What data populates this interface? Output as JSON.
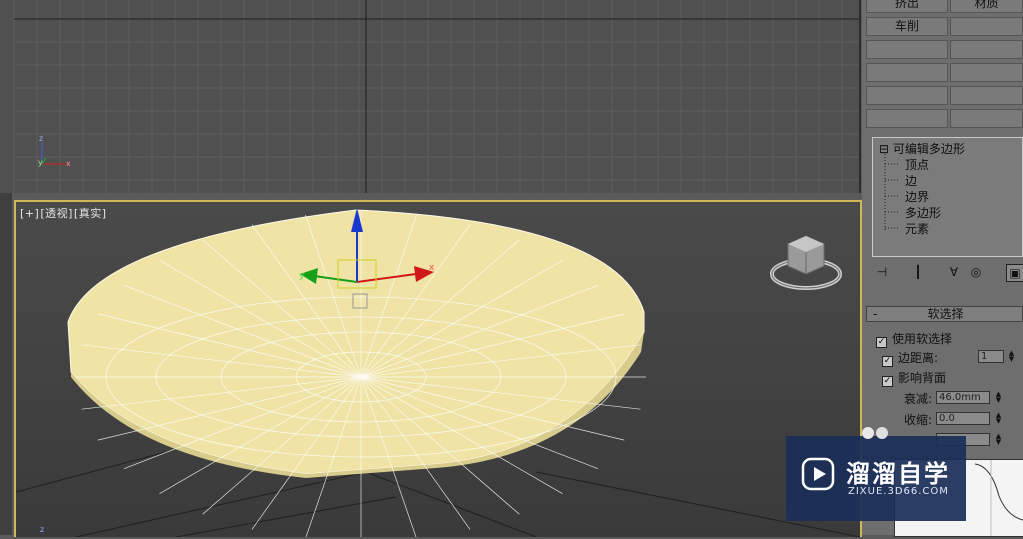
{
  "viewports": {
    "perspective_label": {
      "parts": [
        "[+]",
        "[透视]",
        "[真实]"
      ]
    },
    "axis_labels": {
      "x": "x",
      "y": "y",
      "z": "z"
    }
  },
  "command_panel": {
    "modifier_buttons": [
      "挤出",
      "材质",
      "车削"
    ],
    "stack": {
      "root": "可编辑多边形",
      "expand_symbol": "⊟",
      "items": [
        "顶点",
        "边",
        "边界",
        "多边形",
        "元素"
      ]
    },
    "soft_selection": {
      "title": "软选择",
      "collapse_symbol": "-",
      "use_soft_selection": {
        "label": "使用软选择",
        "checked": true
      },
      "edge_distance": {
        "label": "边距离:",
        "checked": true,
        "value": "1"
      },
      "affect_backfacing": {
        "label": "影响背面",
        "checked": true
      },
      "falloff": {
        "label": "衰减:",
        "value": "46.0mm"
      },
      "pinch": {
        "label": "收缩:",
        "value": "0.0"
      }
    }
  },
  "watermark": {
    "title": "溜溜自学",
    "url": "ZIXUE.3D66.COM"
  },
  "colors": {
    "viewport_active_border": "#d0b85a",
    "mesh_fill": "#efe3a6",
    "gizmo_x": "#d01818",
    "gizmo_y": "#18a018",
    "gizmo_z": "#1838d0"
  }
}
